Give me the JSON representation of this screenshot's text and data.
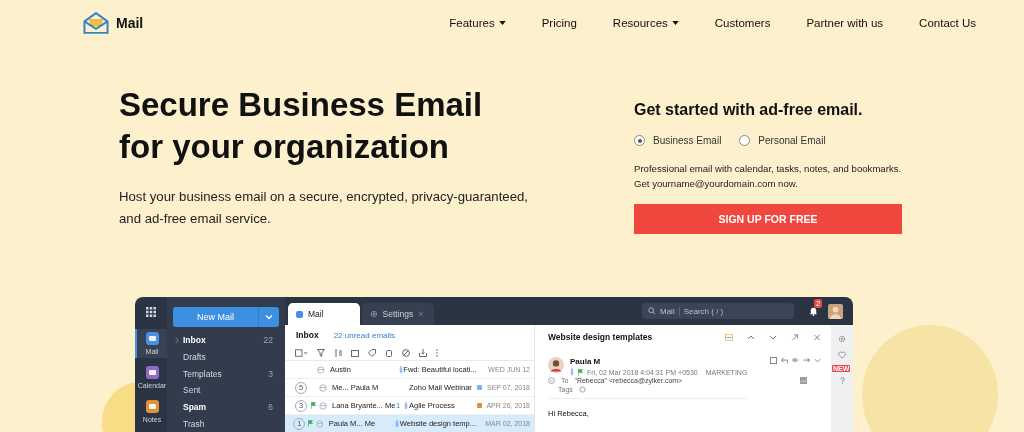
{
  "header": {
    "logo": "Mail",
    "nav": [
      {
        "label": "Features",
        "dropdown": true
      },
      {
        "label": "Pricing",
        "dropdown": false
      },
      {
        "label": "Resources",
        "dropdown": true
      },
      {
        "label": "Customers",
        "dropdown": false
      },
      {
        "label": "Partner with us",
        "dropdown": false
      },
      {
        "label": "Contact Us",
        "dropdown": false
      }
    ]
  },
  "hero": {
    "title_lines": [
      "Secure Business Email",
      "for your organization"
    ],
    "description": "Host your business email on a secure, encrypted, privacy-guaranteed, and ad-free email service."
  },
  "signup": {
    "heading": "Get started with ad-free email.",
    "options": [
      {
        "label": "Business Email",
        "selected": true
      },
      {
        "label": "Personal Email",
        "selected": false
      }
    ],
    "description": "Professional email with calendar, tasks, notes, and bookmarks. Get yourname@yourdomain.com now.",
    "button": "SIGN UP FOR FREE"
  },
  "app": {
    "rail": [
      {
        "label": "Mail",
        "color": "#4a8fe7",
        "selected": true
      },
      {
        "label": "Calendar",
        "color": "#8e6cc6",
        "selected": false
      },
      {
        "label": "Notes",
        "color": "#e0913c",
        "selected": false
      }
    ],
    "new_mail": "New Mail",
    "folders": [
      {
        "label": "Inbox",
        "count": "22",
        "bold": true,
        "expandable": true
      },
      {
        "label": "Drafts",
        "bold": false,
        "expandable": false
      },
      {
        "label": "Templates",
        "count": "3",
        "bold": false,
        "expandable": false
      },
      {
        "label": "Sent",
        "bold": false,
        "expandable": false
      },
      {
        "label": "Spam",
        "count": "6",
        "bold": true,
        "expandable": false
      },
      {
        "label": "Trash",
        "bold": false,
        "expandable": false
      }
    ],
    "tabs": [
      {
        "label": "Mail",
        "selected": true,
        "closable": false
      },
      {
        "label": "Settings",
        "selected": false,
        "closable": true
      }
    ],
    "search": {
      "scope": "Mail",
      "placeholder": "Search ( / )"
    },
    "notifications": "2",
    "list": {
      "title": "Inbox",
      "unread": "22 unread emails",
      "rows": [
        {
          "sender": "Austin",
          "flagged": false,
          "attachment": true,
          "subject": "Fwd: Beautiful locati...",
          "date": "WED JUN 12",
          "selected": false
        },
        {
          "count": "5",
          "sender": "Me... Paula M",
          "flagged": false,
          "attachment": false,
          "subject": "Zoho Mail Webinar",
          "color": "#7fb0e8",
          "date": "SEP 07, 2018",
          "selected": false
        },
        {
          "count": "3",
          "sender": "Lana Bryante... Me",
          "flagged": true,
          "thread": "1",
          "attachment": true,
          "subject": "Agile Process",
          "color": "#d9913a",
          "date": "APR 26, 2018",
          "selected": false
        },
        {
          "count": "1",
          "sender": "Paula M... Me",
          "flagged": true,
          "attachment": true,
          "subject": "Website design temp...",
          "date": "MAR 02, 2018",
          "selected": true
        }
      ]
    },
    "reader": {
      "subject": "Website design templates",
      "sender": "Paula M",
      "flagged": true,
      "attachment": true,
      "datetime": "Fri, 02 Mar 2018 4:04:31 PM +0530",
      "label": "MARKETING",
      "to_label": "To",
      "to": "\"Rebecca\" <rebecca@zylker.com>",
      "tags_label": "Tags",
      "greeting": "Hi Rebecca,"
    },
    "side_badge": "NEW"
  }
}
